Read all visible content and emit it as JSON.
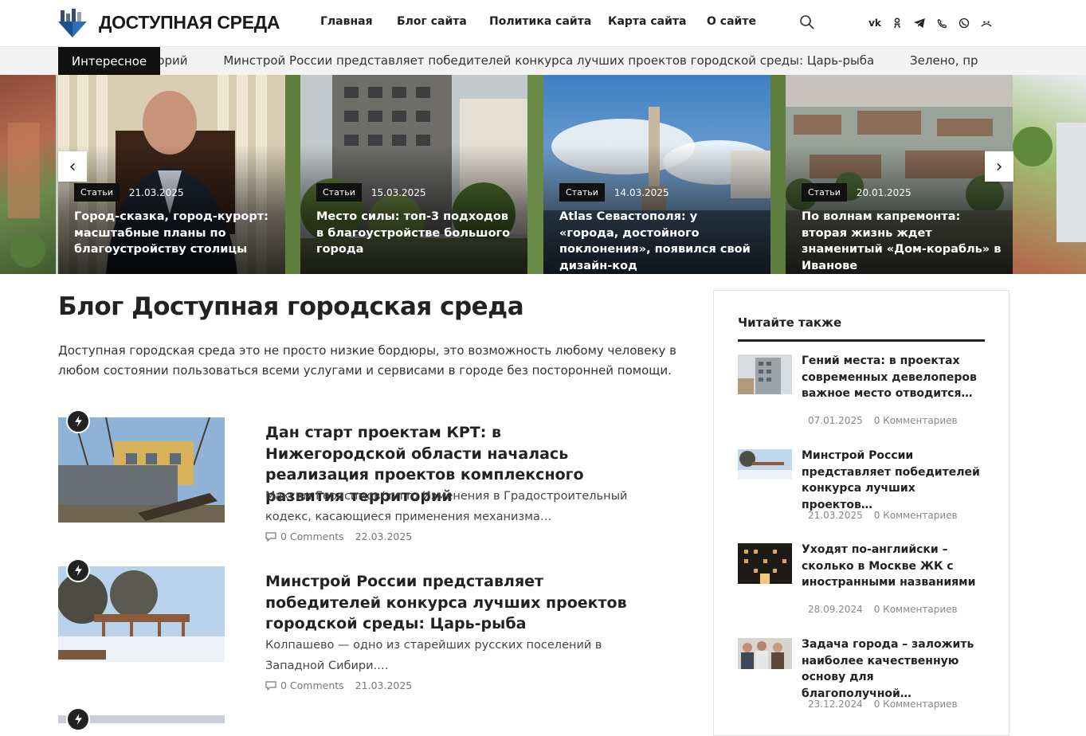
{
  "header": {
    "site_name": "ДОСТУПНАЯ СРЕДА",
    "nav": [
      "Главная",
      "Блог сайта",
      "Политика сайта",
      "Карта сайта",
      "О сайте"
    ],
    "social": [
      "vk-icon",
      "odnoklassniki-icon",
      "telegram-icon",
      "viber-icon",
      "whatsapp-icon",
      "max-icon"
    ]
  },
  "ticker": {
    "label": "Интересное",
    "items": [
      "вития территорий",
      "Минстрой России представляет победителей конкурса лучших проектов городской среды: Царь-рыба",
      "Зелено, пр"
    ]
  },
  "slider": {
    "slides": [
      {
        "category": "Статьи",
        "date": "21.03.2025",
        "title": "Город-сказка, город-курорт: масштабные планы по благоустройству столицы"
      },
      {
        "category": "Статьи",
        "date": "15.03.2025",
        "title": "Место силы: топ-3 подходов в благоустройстве большого города"
      },
      {
        "category": "Статьи",
        "date": "14.03.2025",
        "title": "Atlas Севастополя: у «города, достойного поклонения», появился свой дизайн-код"
      },
      {
        "category": "Статьи",
        "date": "20.01.2025",
        "title": "По волнам капремонта: вторая жизнь ждет знаменитый «Дом-корабль» в Иванове"
      }
    ],
    "prev": "‹",
    "next": "›"
  },
  "main": {
    "title": "Блог Доступная городская среда",
    "description": "Доступная городская среда это не просто низкие бордюры, это возможность любому человеку в любом состоянии пользоваться всеми услугами и сервисами в городе без посторонней помощи.",
    "posts": [
      {
        "title": "Дан старт проектам КРТ: в Нижегородской области началась реализация проектов комплексного развития территорий",
        "excerpt": "Максим Герасимов/ nn.ru Изменения в Градостроительный кодекс, касающиеся применения механизма…",
        "comments": "0 Comments",
        "date": "22.03.2025"
      },
      {
        "title": "Минстрой России представляет победителей конкурса лучших проектов городской среды: Царь-рыба",
        "excerpt": "Колпашево — одно из старейших русских поселений в Западной Сибири.…",
        "comments": "0 Comments",
        "date": "21.03.2025"
      }
    ]
  },
  "sidebar": {
    "title": "Читайте также",
    "items": [
      {
        "title": "Гений места: в проектах современных девелоперов важное место отводится…",
        "date": "07.01.2025",
        "comments": "0 Комментариев"
      },
      {
        "title": "Минстрой России представляет победителей конкурса лучших проектов…",
        "date": "21.03.2025",
        "comments": "0 Комментариев"
      },
      {
        "title": "Уходят по-английски – сколько в Москве ЖК с иностранными названиями",
        "date": "28.09.2024",
        "comments": "0 Комментариев"
      },
      {
        "title": "Задача города – заложить наиболее качественную основу для благополучной…",
        "date": "23.12.2024",
        "comments": "0 Комментариев"
      }
    ]
  }
}
